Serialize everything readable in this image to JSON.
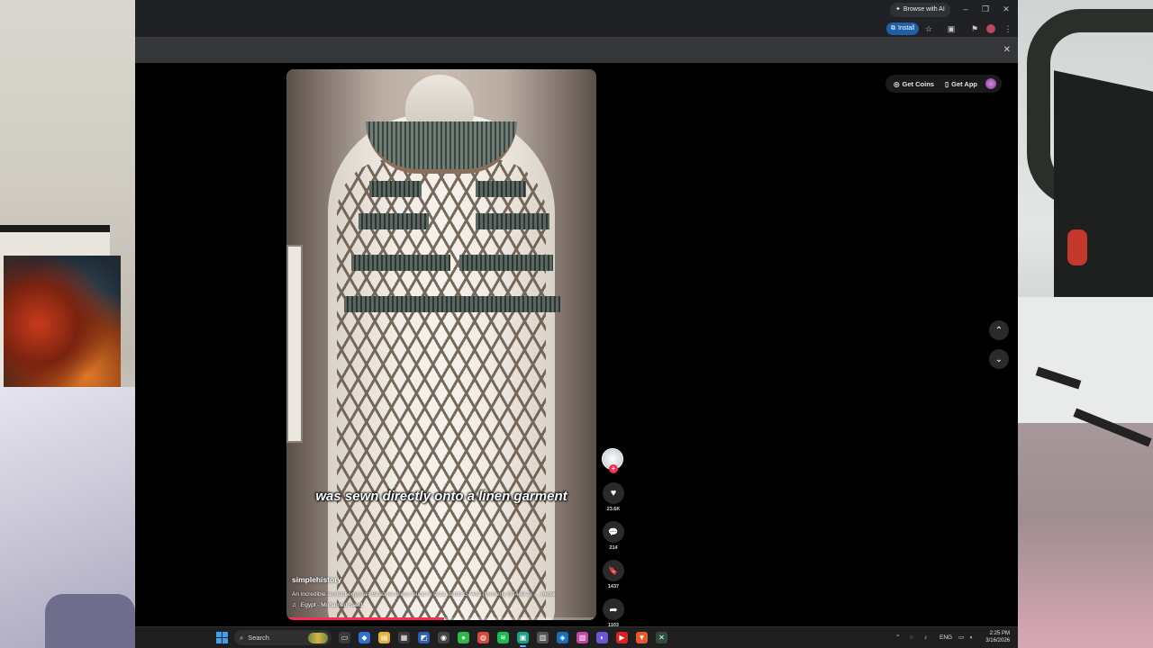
{
  "browser": {
    "browse_ai_label": "Browse with AI",
    "install_label": "Install",
    "window_controls": [
      "–",
      "❐",
      "✕"
    ],
    "infobar_close": "✕"
  },
  "tiktok": {
    "get_coins_label": "Get Coins",
    "get_app_label": "Get App",
    "caption_overlay": "was sewn directly onto a linen garment",
    "username": "simplehistory",
    "description": "An incredible ancient egyptian Beadnet dress found in Giza, tomb G7442 (formerly G7440 Z) …",
    "more_label": "more",
    "music": "Egypt - Mohamed Saed",
    "progress_fraction": 0.51,
    "likes": "23.6K",
    "comments": "214",
    "saves": "1437",
    "shares": "1103",
    "follow_plus": "+"
  },
  "taskbar": {
    "search_label": "Search",
    "language": "ENG",
    "time": "2:25 PM",
    "date": "3/16/2026"
  },
  "icons": {
    "heart": "♥",
    "comment": "💬",
    "bookmark": "🔖",
    "share": "➦",
    "up": "⌃",
    "down": "⌄",
    "music": "♫"
  },
  "colors": {
    "accent_red": "#fe2c55",
    "install_blue": "#1f5fa8"
  }
}
